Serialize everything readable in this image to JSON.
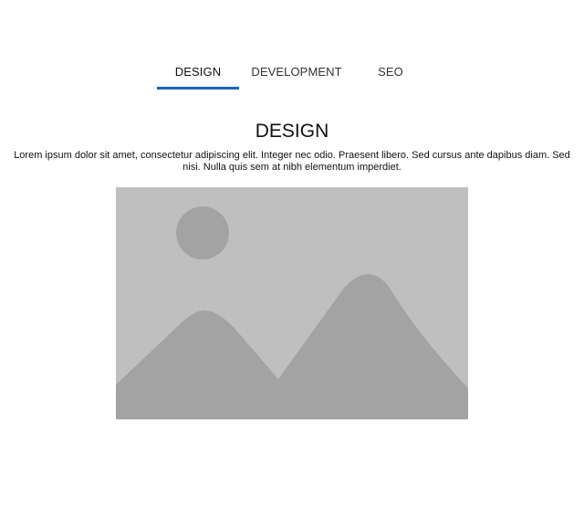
{
  "tabs": [
    {
      "label": "DESIGN",
      "active": true
    },
    {
      "label": "DEVELOPMENT",
      "active": false
    },
    {
      "label": "SEO",
      "active": false
    }
  ],
  "panel": {
    "title": "DESIGN",
    "text": "Lorem ipsum dolor sit amet, consectetur adipiscing elit. Integer nec odio. Praesent libero. Sed cursus ante dapibus diam. Sed nisi. Nulla quis sem at nibh elementum imperdiet.",
    "image": {
      "icon": "image-placeholder-icon",
      "background_color": "#bfbfbf",
      "shape_color": "#a3a3a3"
    }
  },
  "colors": {
    "accent": "#1565c0"
  }
}
